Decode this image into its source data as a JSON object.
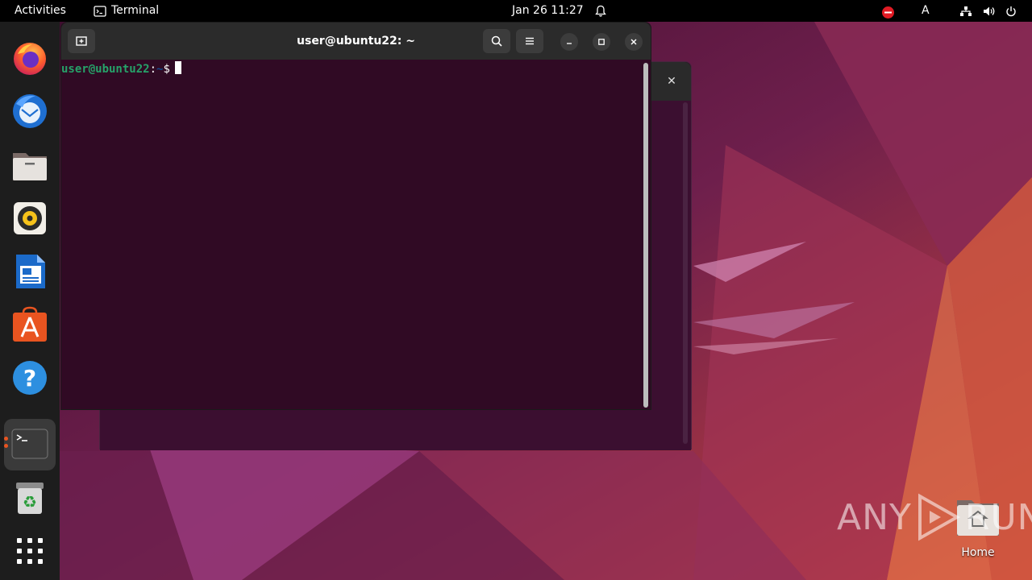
{
  "topbar": {
    "activities": "Activities",
    "app_name": "Terminal",
    "clock": "Jan 26  11:27",
    "keyboard_layout": "A"
  },
  "dock": {
    "items": [
      {
        "name": "Firefox",
        "icon": "firefox-icon"
      },
      {
        "name": "Thunderbird Mail",
        "icon": "thunderbird-icon"
      },
      {
        "name": "Files",
        "icon": "files-icon"
      },
      {
        "name": "Rhythmbox",
        "icon": "rhythmbox-icon"
      },
      {
        "name": "LibreOffice Writer",
        "icon": "writer-icon"
      },
      {
        "name": "Ubuntu Software",
        "icon": "software-icon"
      },
      {
        "name": "Help",
        "icon": "help-icon"
      },
      {
        "name": "Terminal",
        "icon": "terminal-icon",
        "active": true
      },
      {
        "name": "Trash",
        "icon": "trash-icon"
      },
      {
        "name": "Show Applications",
        "icon": "app-grid-icon"
      }
    ]
  },
  "terminal": {
    "title": "user@ubuntu22: ~",
    "prompt_user": "user@ubuntu22",
    "prompt_sep": ":",
    "prompt_path": "~",
    "prompt_symbol": "$"
  },
  "desktop": {
    "home_label": "Home"
  },
  "watermark": {
    "left": "ANY",
    "right": "RUN"
  },
  "colors": {
    "accent": "#e95420",
    "terminal_bg": "#300a24",
    "prompt_user": "#26a269",
    "prompt_path": "#12488b"
  }
}
